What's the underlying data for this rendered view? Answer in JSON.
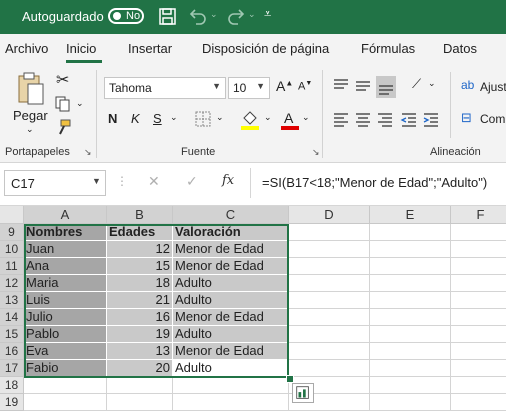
{
  "titlebar": {
    "autosave_label": "Autoguardado",
    "toggle_state": "No"
  },
  "tabs": [
    "Archivo",
    "Inicio",
    "Insertar",
    "Disposición de página",
    "Fórmulas",
    "Datos"
  ],
  "ribbon": {
    "paste_label": "Pegar",
    "clipboard_group": "Portapapeles",
    "font_name": "Tahoma",
    "font_size": "10",
    "bold": "N",
    "italic": "K",
    "underline": "S",
    "font_group": "Fuente",
    "wrap_label": "Ajust",
    "merge_label": "Com",
    "alignment_group": "Alineación"
  },
  "formula_bar": {
    "name_box": "C17",
    "fx": "fx",
    "formula": "=SI(B17<18;\"Menor de Edad\";\"Adulto\")"
  },
  "columns": [
    "A",
    "B",
    "C",
    "D",
    "E",
    "F"
  ],
  "rows": [
    "9",
    "10",
    "11",
    "12",
    "13",
    "14",
    "15",
    "16",
    "17",
    "18",
    "19"
  ],
  "table": {
    "headers": [
      "Nombres",
      "Edades",
      "Valoración"
    ],
    "data": [
      [
        "Juan",
        "12",
        "Menor de Edad"
      ],
      [
        "Ana",
        "15",
        "Menor de Edad"
      ],
      [
        "Maria",
        "18",
        "Adulto"
      ],
      [
        "Luis",
        "21",
        "Adulto"
      ],
      [
        "Julio",
        "16",
        "Menor de Edad"
      ],
      [
        "Pablo",
        "19",
        "Adulto"
      ],
      [
        "Eva",
        "13",
        "Menor de Edad"
      ],
      [
        "Fabio",
        "20",
        "Adulto"
      ]
    ]
  },
  "colors": {
    "accent": "#217346",
    "col_a_fill": "#a6a6a6",
    "col_bc_fill": "#c9c9c9"
  }
}
